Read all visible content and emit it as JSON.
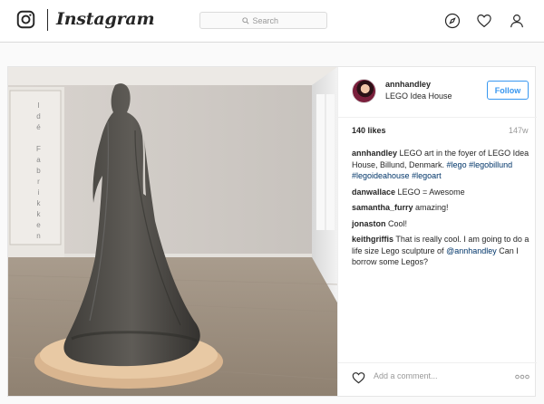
{
  "nav": {
    "brand": "Instagram",
    "search_placeholder": "Search",
    "icons": [
      "instagram-logo-icon",
      "compass-icon",
      "heart-icon",
      "user-icon"
    ]
  },
  "post": {
    "author": "annhandley",
    "location": "LEGO Idea House",
    "follow_label": "Follow",
    "likes": "140 likes",
    "age": "147w",
    "photo_wall_text": "Idé Fabrikken",
    "caption": {
      "user": "annhandley",
      "text": " LEGO art in the foyer of LEGO Idea House, Billund, Denmark. ",
      "tags": [
        "#lego",
        "#legobillund",
        "#legoideahouse",
        "#legoart"
      ]
    },
    "comments": [
      {
        "user": "danwallace",
        "text": " LEGO = Awesome"
      },
      {
        "user": "samantha_furry",
        "text": " amazing!"
      },
      {
        "user": "jonaston",
        "text": " Cool!"
      },
      {
        "user": "keithgriffis",
        "text": " That is really cool. I am going to do a life size Lego sculpture of ",
        "mention": "@annhandley",
        "text2": " Can I borrow some Legos?"
      }
    ],
    "add_comment_placeholder": "Add a comment...",
    "link_color": "#003569",
    "accent_color": "#3897f0"
  }
}
